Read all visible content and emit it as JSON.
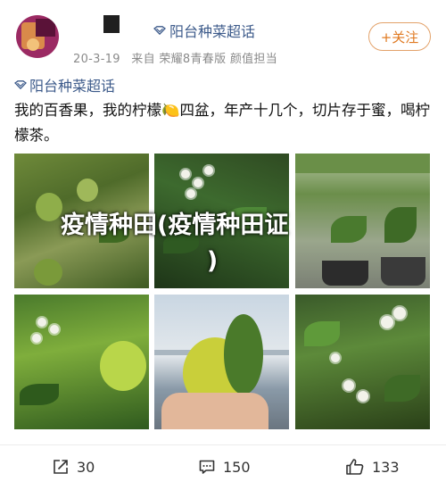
{
  "post": {
    "topic_top": "阳台种菜超话",
    "meta_date": "20-3-19",
    "meta_source": "来自 荣耀8青春版 颜值担当",
    "follow_label": "+关注",
    "topic_line": "阳台种菜超话",
    "body_text": "我的百香果，我的柠檬🍋四盆，年产十几个，切片存于蜜，喝柠檬茶。",
    "overlay_line1": "疫情种田(疫情种田证",
    "overlay_line2": ")"
  },
  "actions": {
    "share_count": "30",
    "comment_count": "150",
    "like_count": "133"
  },
  "colors": {
    "topic_blue": "#3c5a8a",
    "follow_orange": "#e07a22",
    "meta_gray": "#8a8a8a"
  },
  "icons": [
    "topic-diamond-icon",
    "share-icon",
    "comment-icon",
    "like-icon"
  ]
}
